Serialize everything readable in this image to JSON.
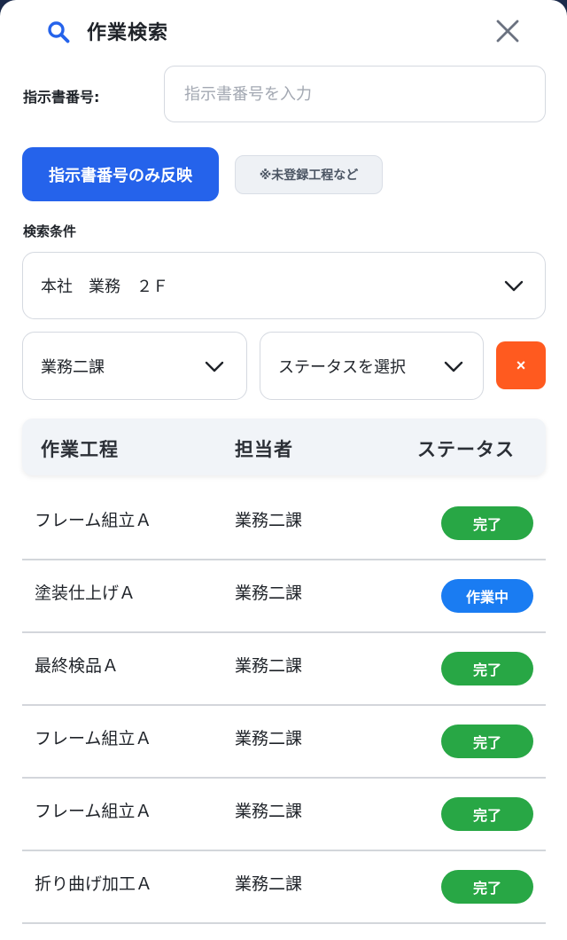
{
  "header": {
    "title": "作業検索",
    "search_icon": "search-icon",
    "close_icon": "close-icon"
  },
  "order_number": {
    "label": "指示書番号:",
    "value": "",
    "placeholder": "指示書番号を入力"
  },
  "actions": {
    "apply_label": "指示書番号のみ反映",
    "note_label": "※未登録工程など"
  },
  "filters": {
    "section_label": "検索条件",
    "location": {
      "selected": "本社　業務　２Ｆ"
    },
    "department": {
      "selected": "業務二課"
    },
    "status": {
      "placeholder": "ステータスを選択"
    },
    "clear_label": "×"
  },
  "table": {
    "columns": [
      "作業工程",
      "担当者",
      "ステータス"
    ],
    "rows": [
      {
        "process": "フレーム組立Ａ",
        "owner": "業務二課",
        "status": "完了"
      },
      {
        "process": "塗装仕上げＡ",
        "owner": "業務二課",
        "status": "作業中"
      },
      {
        "process": "最終検品Ａ",
        "owner": "業務二課",
        "status": "完了"
      },
      {
        "process": "フレーム組立Ａ",
        "owner": "業務二課",
        "status": "完了"
      },
      {
        "process": "フレーム組立Ａ",
        "owner": "業務二課",
        "status": "完了"
      },
      {
        "process": "折り曲げ加工Ａ",
        "owner": "業務二課",
        "status": "完了"
      }
    ]
  },
  "colors": {
    "primary": "#2563eb",
    "danger": "#ff5a1f",
    "status_done": "#28a745",
    "status_active": "#1a7cf2"
  }
}
